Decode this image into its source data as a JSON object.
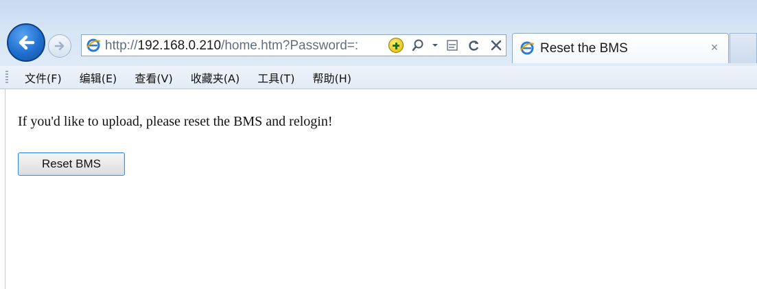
{
  "browser": {
    "url": {
      "scheme": "http://",
      "host": "192.168.0.210",
      "path": "/home.htm?Password=:"
    },
    "tab": {
      "title": "Reset the BMS",
      "close_glyph": "×"
    },
    "nav_icons": {
      "back": "back-arrow-icon",
      "forward": "forward-arrow-icon"
    },
    "address_tools": [
      "compatibility-plus-icon",
      "search-icon",
      "dropdown-icon",
      "compatibility-view-icon",
      "refresh-icon",
      "stop-icon"
    ],
    "accent_color": "#1f6fd0"
  },
  "menubar": {
    "items": [
      "文件(F)",
      "编辑(E)",
      "查看(V)",
      "收藏夹(A)",
      "工具(T)",
      "帮助(H)"
    ]
  },
  "page": {
    "message": "If you'd like to upload, please reset the BMS and relogin!",
    "reset_button_label": "Reset BMS"
  }
}
